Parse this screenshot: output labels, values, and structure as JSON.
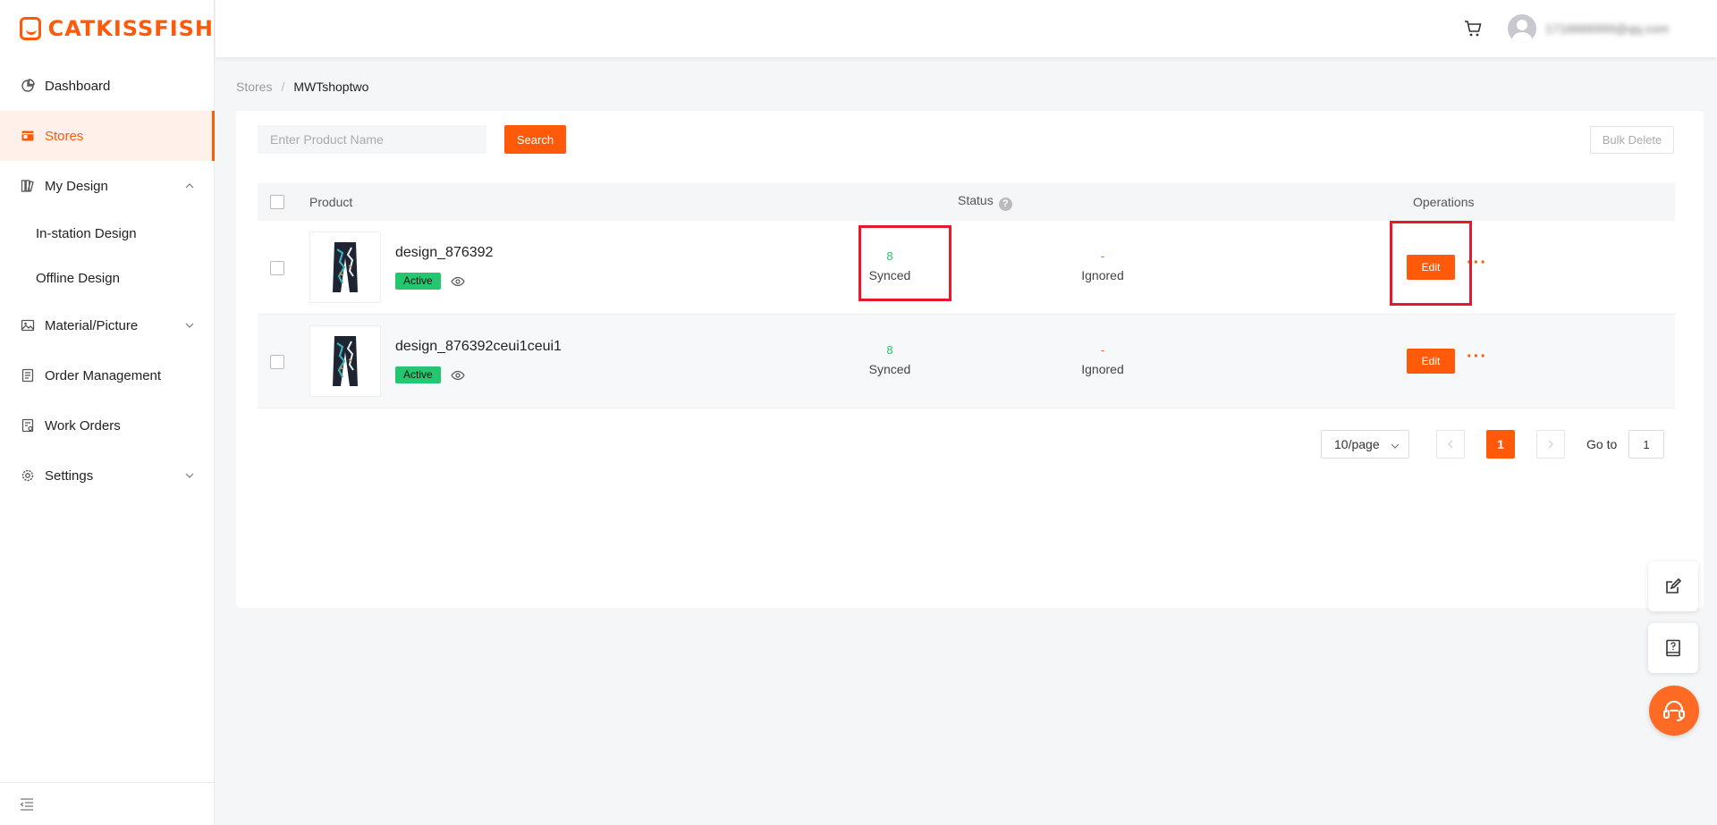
{
  "brand": {
    "name": "CATKISSFISH",
    "accent": "#ff5a0a"
  },
  "sidebar": {
    "items": [
      {
        "label": "Dashboard",
        "icon": "pie-chart-icon"
      },
      {
        "label": "Stores",
        "icon": "store-icon",
        "active": true
      },
      {
        "label": "My Design",
        "icon": "design-icon",
        "expanded": true,
        "children": [
          {
            "label": "In-station Design"
          },
          {
            "label": "Offline Design"
          }
        ]
      },
      {
        "label": "Material/Picture",
        "icon": "image-icon"
      },
      {
        "label": "Order Management",
        "icon": "order-icon"
      },
      {
        "label": "Work Orders",
        "icon": "work-order-icon"
      },
      {
        "label": "Settings",
        "icon": "gear-icon"
      }
    ]
  },
  "header": {
    "user_email": "1716666999@qq.com"
  },
  "breadcrumb": {
    "parent": "Stores",
    "separator": "/",
    "current": "MWTshoptwo"
  },
  "toolbar": {
    "search_placeholder": "Enter Product Name",
    "search_label": "Search",
    "bulk_delete_label": "Bulk Delete"
  },
  "table": {
    "columns": {
      "product": "Product",
      "status": "Status",
      "operations": "Operations",
      "status_help": "?"
    },
    "rows": [
      {
        "name": "design_876392",
        "badge": "Active",
        "synced_count": "8",
        "synced_label": "Synced",
        "ignored_count": "-",
        "ignored_label": "Ignored",
        "edit_label": "Edit",
        "more_label": "···"
      },
      {
        "name": "design_876392ceui1ceui1",
        "badge": "Active",
        "synced_count": "8",
        "synced_label": "Synced",
        "ignored_count": "-",
        "ignored_label": "Ignored",
        "edit_label": "Edit",
        "more_label": "···"
      }
    ]
  },
  "pagination": {
    "page_size": "10/page",
    "current_page": "1",
    "goto_label": "Go to",
    "goto_value": "1"
  }
}
